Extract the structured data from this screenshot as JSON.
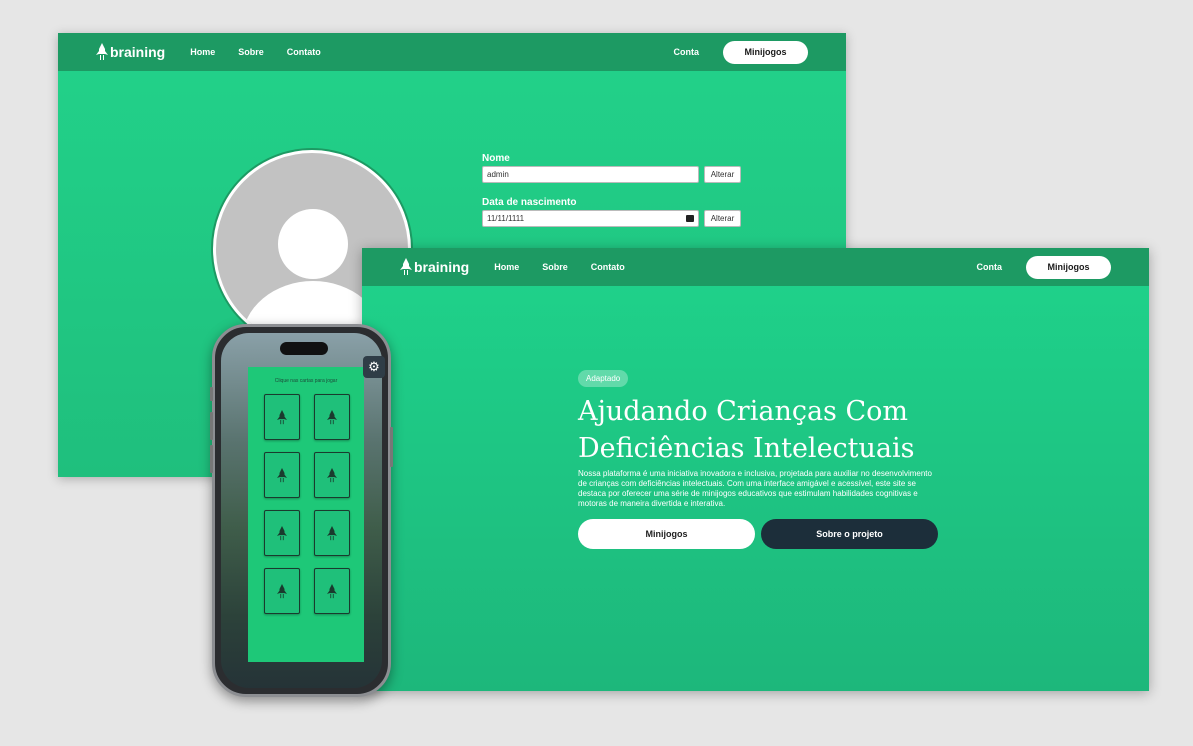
{
  "brand": {
    "name": "braining"
  },
  "nav": {
    "home": "Home",
    "about": "Sobre",
    "contact": "Contato",
    "account": "Conta",
    "minigames": "Minijogos"
  },
  "profile": {
    "name_label": "Nome",
    "name_value": "admin",
    "change_label": "Alterar",
    "birth_label": "Data de nascimento",
    "birth_value": "11/11/1111"
  },
  "hero": {
    "badge": "Adaptado",
    "title": "Ajudando Crianças Com Deficiências Intelectuais",
    "description": "Nossa plataforma é uma iniciativa inovadora e inclusiva, projetada para auxiliar no desenvolvimento de crianças com deficiências intelectuais. Com uma interface amigável e acessível, este site se destaca por oferecer uma série de minijogos educativos que estimulam habilidades cognitivas e motoras de maneira divertida e interativa.",
    "primary_button": "Minijogos",
    "secondary_button": "Sobre o projeto"
  },
  "mobile_game": {
    "instruction": "Clique nas cartas para jogar",
    "cards": 8
  },
  "colors": {
    "brand_green": "#1fd38b",
    "nav_green": "#1d9a63",
    "dark_button": "#1c2e3a"
  },
  "icons": [
    "rocket-icon",
    "calendar-icon",
    "gear-icon",
    "user-avatar-icon"
  ]
}
